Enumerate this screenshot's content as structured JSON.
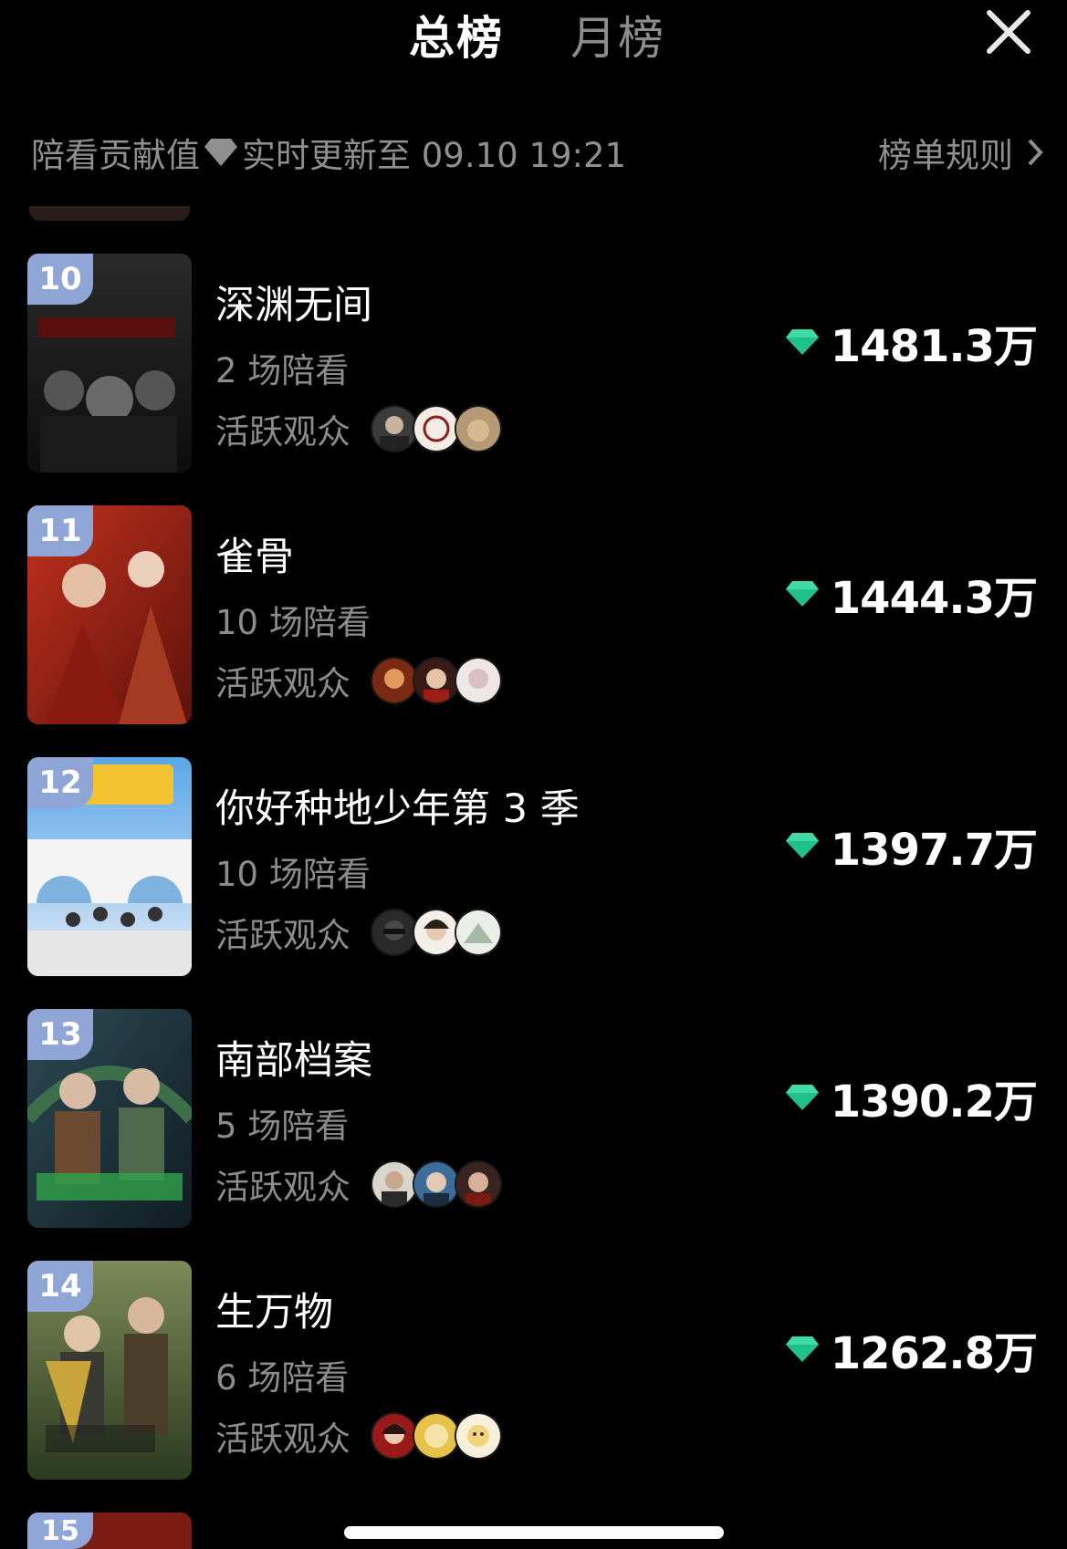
{
  "tabs": {
    "overall": "总榜",
    "monthly": "月榜"
  },
  "info": {
    "metric_label": "陪看贡献值",
    "update_text": "实时更新至 09.10 19:21",
    "rules_label": "榜单规则"
  },
  "colors": {
    "gem": "#1fc08a",
    "badge": "#8fa5d6",
    "muted": "#8c8c8c"
  },
  "rows": [
    {
      "rank": "10",
      "title": "深渊无间",
      "sessions": "2 场陪看",
      "audience_label": "活跃观众",
      "score": "1481.3万"
    },
    {
      "rank": "11",
      "title": "雀骨",
      "sessions": "10 场陪看",
      "audience_label": "活跃观众",
      "score": "1444.3万"
    },
    {
      "rank": "12",
      "title": "你好种地少年第 3 季",
      "sessions": "10 场陪看",
      "audience_label": "活跃观众",
      "score": "1397.7万"
    },
    {
      "rank": "13",
      "title": "南部档案",
      "sessions": "5 场陪看",
      "audience_label": "活跃观众",
      "score": "1390.2万"
    },
    {
      "rank": "14",
      "title": "生万物",
      "sessions": "6 场陪看",
      "audience_label": "活跃观众",
      "score": "1262.8万"
    }
  ],
  "next_rank": "15"
}
